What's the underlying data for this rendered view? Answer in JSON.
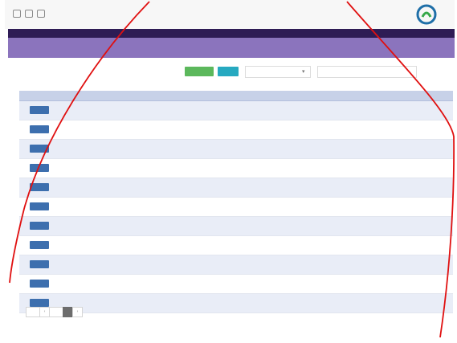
{
  "window": {
    "breadcrumb": "",
    "brand_name": "",
    "colors": {
      "header_dark": "#2e1c55",
      "header": "#8b74bd",
      "row_alt": "#e9edf7",
      "button": "#3d6fae",
      "annotation": "#e01010"
    }
  },
  "page": {
    "title": ""
  },
  "filters": {
    "label": "",
    "search_placeholder": "",
    "select_value": "",
    "select_chevron": "▾",
    "green_button_label": "",
    "teal_button_label": ""
  },
  "table": {
    "columns": [
      "",
      "",
      "",
      "",
      "",
      "",
      "",
      "",
      "",
      "",
      "",
      ""
    ],
    "rows": [
      {
        "code": "",
        "key": "",
        "action": ""
      },
      {
        "code": "",
        "key": "",
        "action": ""
      },
      {
        "code": "",
        "key": "",
        "action": ""
      },
      {
        "code": "",
        "key": "",
        "action": ""
      },
      {
        "code": "",
        "key": "",
        "action": ""
      },
      {
        "code": "",
        "key": "",
        "action": ""
      },
      {
        "code": "",
        "key": "",
        "action": ""
      },
      {
        "code": "",
        "key": "",
        "action": ""
      },
      {
        "code": "",
        "key": "",
        "action": ""
      },
      {
        "code": "",
        "key": "",
        "action": ""
      },
      {
        "code": "",
        "key": "",
        "action": ""
      }
    ]
  },
  "pagination": {
    "prev": "‹",
    "next": "›",
    "current_page": ""
  }
}
